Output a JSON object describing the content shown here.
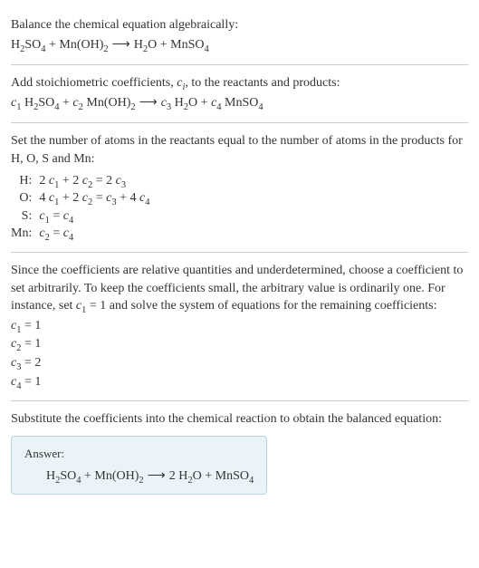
{
  "intro": {
    "line1": "Balance the chemical equation algebraically:",
    "eq": "H₂SO₄ + Mn(OH)₂ ⟶ H₂O + MnSO₄"
  },
  "stoich": {
    "line1": "Add stoichiometric coefficients, cᵢ, to the reactants and products:",
    "eq": "c₁ H₂SO₄ + c₂ Mn(OH)₂ ⟶ c₃ H₂O + c₄ MnSO₄"
  },
  "atoms": {
    "line1": "Set the number of atoms in the reactants equal to the number of atoms in the products for H, O, S and Mn:",
    "rows": [
      {
        "label": "H:",
        "eq": "2 c₁ + 2 c₂ = 2 c₃"
      },
      {
        "label": "O:",
        "eq": "4 c₁ + 2 c₂ = c₃ + 4 c₄"
      },
      {
        "label": "S:",
        "eq": "c₁ = c₄"
      },
      {
        "label": "Mn:",
        "eq": "c₂ = c₄"
      }
    ]
  },
  "solve": {
    "para": "Since the coefficients are relative quantities and underdetermined, choose a coefficient to set arbitrarily. To keep the coefficients small, the arbitrary value is ordinarily one. For instance, set c₁ = 1 and solve the system of equations for the remaining coefficients:",
    "coefs": [
      "c₁ = 1",
      "c₂ = 1",
      "c₃ = 2",
      "c₄ = 1"
    ]
  },
  "subst": {
    "line1": "Substitute the coefficients into the chemical reaction to obtain the balanced equation:"
  },
  "answer": {
    "label": "Answer:",
    "eq": "H₂SO₄ + Mn(OH)₂ ⟶ 2 H₂O + MnSO₄"
  },
  "chart_data": {
    "type": "table",
    "title": "Balancing H2SO4 + Mn(OH)2 -> H2O + MnSO4",
    "element_balance": [
      {
        "element": "H",
        "equation": "2c1 + 2c2 = 2c3"
      },
      {
        "element": "O",
        "equation": "4c1 + 2c2 = c3 + 4c4"
      },
      {
        "element": "S",
        "equation": "c1 = c4"
      },
      {
        "element": "Mn",
        "equation": "c2 = c4"
      }
    ],
    "solution": {
      "c1": 1,
      "c2": 1,
      "c3": 2,
      "c4": 1
    },
    "balanced_equation": "H2SO4 + Mn(OH)2 -> 2 H2O + MnSO4"
  }
}
